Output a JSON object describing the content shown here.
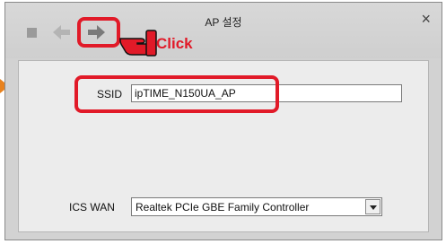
{
  "window": {
    "title": "AP 설정",
    "close_glyph": "×"
  },
  "toolbar": {
    "icons": [
      "stop-icon",
      "back-arrow-icon",
      "forward-arrow-icon"
    ]
  },
  "annotation": {
    "click_label": "Click",
    "highlight_color": "#e11a28",
    "pointer_color": "#e8821e"
  },
  "form": {
    "ssid_label": "SSID",
    "ssid_value": "ipTIME_N150UA_AP",
    "ics_wan_label": "ICS WAN",
    "ics_wan_value": "Realtek PCIe GBE Family Controller"
  }
}
